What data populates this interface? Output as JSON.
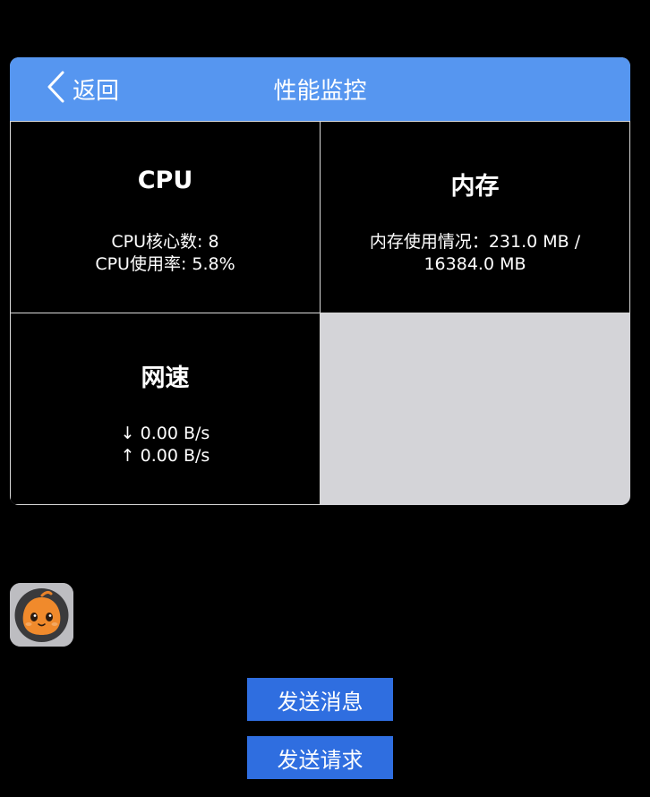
{
  "navbar": {
    "back_label": "返回",
    "title": "性能监控"
  },
  "cards": {
    "cpu": {
      "title": "CPU",
      "lines": [
        "CPU核心数: 8",
        "CPU使用率: 5.8%"
      ]
    },
    "memory": {
      "title": "内存",
      "lines": [
        "内存使用情况：231.0 MB /",
        "16384.0 MB"
      ]
    },
    "network": {
      "title": "网速",
      "lines": [
        "↓ 0.00 B/s",
        "↑ 0.00 B/s"
      ]
    }
  },
  "buttons": {
    "send_message": "发送消息",
    "send_request": "发送请求"
  },
  "avatar": {
    "icon": "pumpkin-mascot-icon"
  },
  "colors": {
    "navbar": "#5696f0",
    "button": "#2f6ee0",
    "panel_background": "#d4d4d8",
    "page_background": "#000000"
  }
}
